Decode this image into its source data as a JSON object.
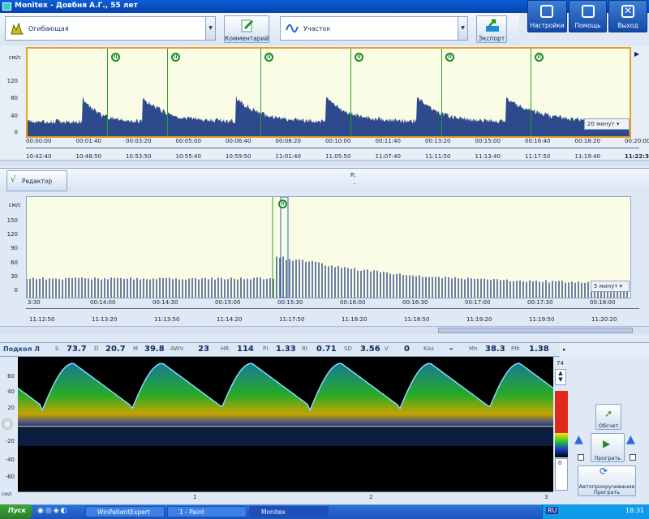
{
  "window": {
    "title": "Monitex - Довбня А.Г., 55 лет"
  },
  "topbar": {
    "settings": "Настройки",
    "help": "Помощь",
    "exit": "Выход"
  },
  "toolbar": {
    "envelope_select": "Огибающая",
    "comment": "Комментарий",
    "section_select": "Участок",
    "export": "Экспорт"
  },
  "overview": {
    "yunit": "см/с",
    "yticks": [
      "120",
      "80",
      "40",
      "0"
    ],
    "time_ticks": [
      "00:00:00",
      "00:01:40",
      "00:03:20",
      "00:05:00",
      "00:06:40",
      "00:08:20",
      "00:10:00",
      "00:11:40",
      "00:13:20",
      "00:15:00",
      "00:16:40",
      "00:18:20",
      "00:20:00"
    ],
    "clock_ticks": [
      "10:42:40",
      "10:48:50",
      "10:53:50",
      "10:55:40",
      "10:59:50",
      "11:01:40",
      "11:05:50",
      "11:07:40",
      "11:11:50",
      "11:13:40",
      "11:17:50",
      "11:19:40",
      "11:22:30"
    ],
    "markers": [
      "II",
      "II",
      "II",
      "II",
      "II",
      "II"
    ],
    "span_select": "20 минут"
  },
  "detail": {
    "editor": "Редактор",
    "r_label": "R:",
    "r_value": "-",
    "yunit": "см/с",
    "yticks": [
      "150",
      "120",
      "90",
      "60",
      "30",
      "0"
    ],
    "time_ticks": [
      "3:30",
      "00:14:00",
      "00:14:30",
      "00:15:00",
      "00:15:30",
      "00:16:00",
      "00:16:30",
      "00:17:00",
      "00:17:30",
      "00:18:00"
    ],
    "clock_ticks": [
      "11:12:50",
      "11:13:20",
      "11:13:50",
      "11:14:20",
      "11:17:50",
      "11:18:20",
      "11:18:50",
      "11:19:20",
      "11:19:50",
      "11:20:20"
    ],
    "marker": "II",
    "span_select": "5 минут"
  },
  "metrics": {
    "channel": "Подкол Л",
    "items": [
      {
        "label": "S",
        "value": "73.7"
      },
      {
        "label": "D",
        "value": "20.7"
      },
      {
        "label": "M",
        "value": "39.8"
      },
      {
        "label": "AWV",
        "value": "23"
      },
      {
        "label": "HR",
        "value": "114"
      },
      {
        "label": "PI",
        "value": "1.33"
      },
      {
        "label": "RI",
        "value": "0.71"
      },
      {
        "label": "SD",
        "value": "3.56"
      },
      {
        "label": "V",
        "value": "0"
      },
      {
        "label": "KAs",
        "value": "-"
      },
      {
        "label": "Mn",
        "value": "38.3"
      },
      {
        "label": "PIh",
        "value": "1.38"
      }
    ]
  },
  "spectrum": {
    "yticks": [
      "60",
      "40",
      "20",
      "-20",
      "-40",
      "-60"
    ],
    "unit": "см/с",
    "x_ticks": [
      "1",
      "2",
      "3"
    ],
    "scale_max": "74",
    "scale_min": "0",
    "calc_button": "Обсчет",
    "play_button": "Програть",
    "autoplay_button": "Автопрокручивание Програть"
  },
  "taskbar": {
    "start": "Пуск",
    "tasks": [
      "WinPatientExpert",
      "1 - Paint",
      "Monitex"
    ],
    "lang": "RU",
    "clock": "18:31"
  }
}
